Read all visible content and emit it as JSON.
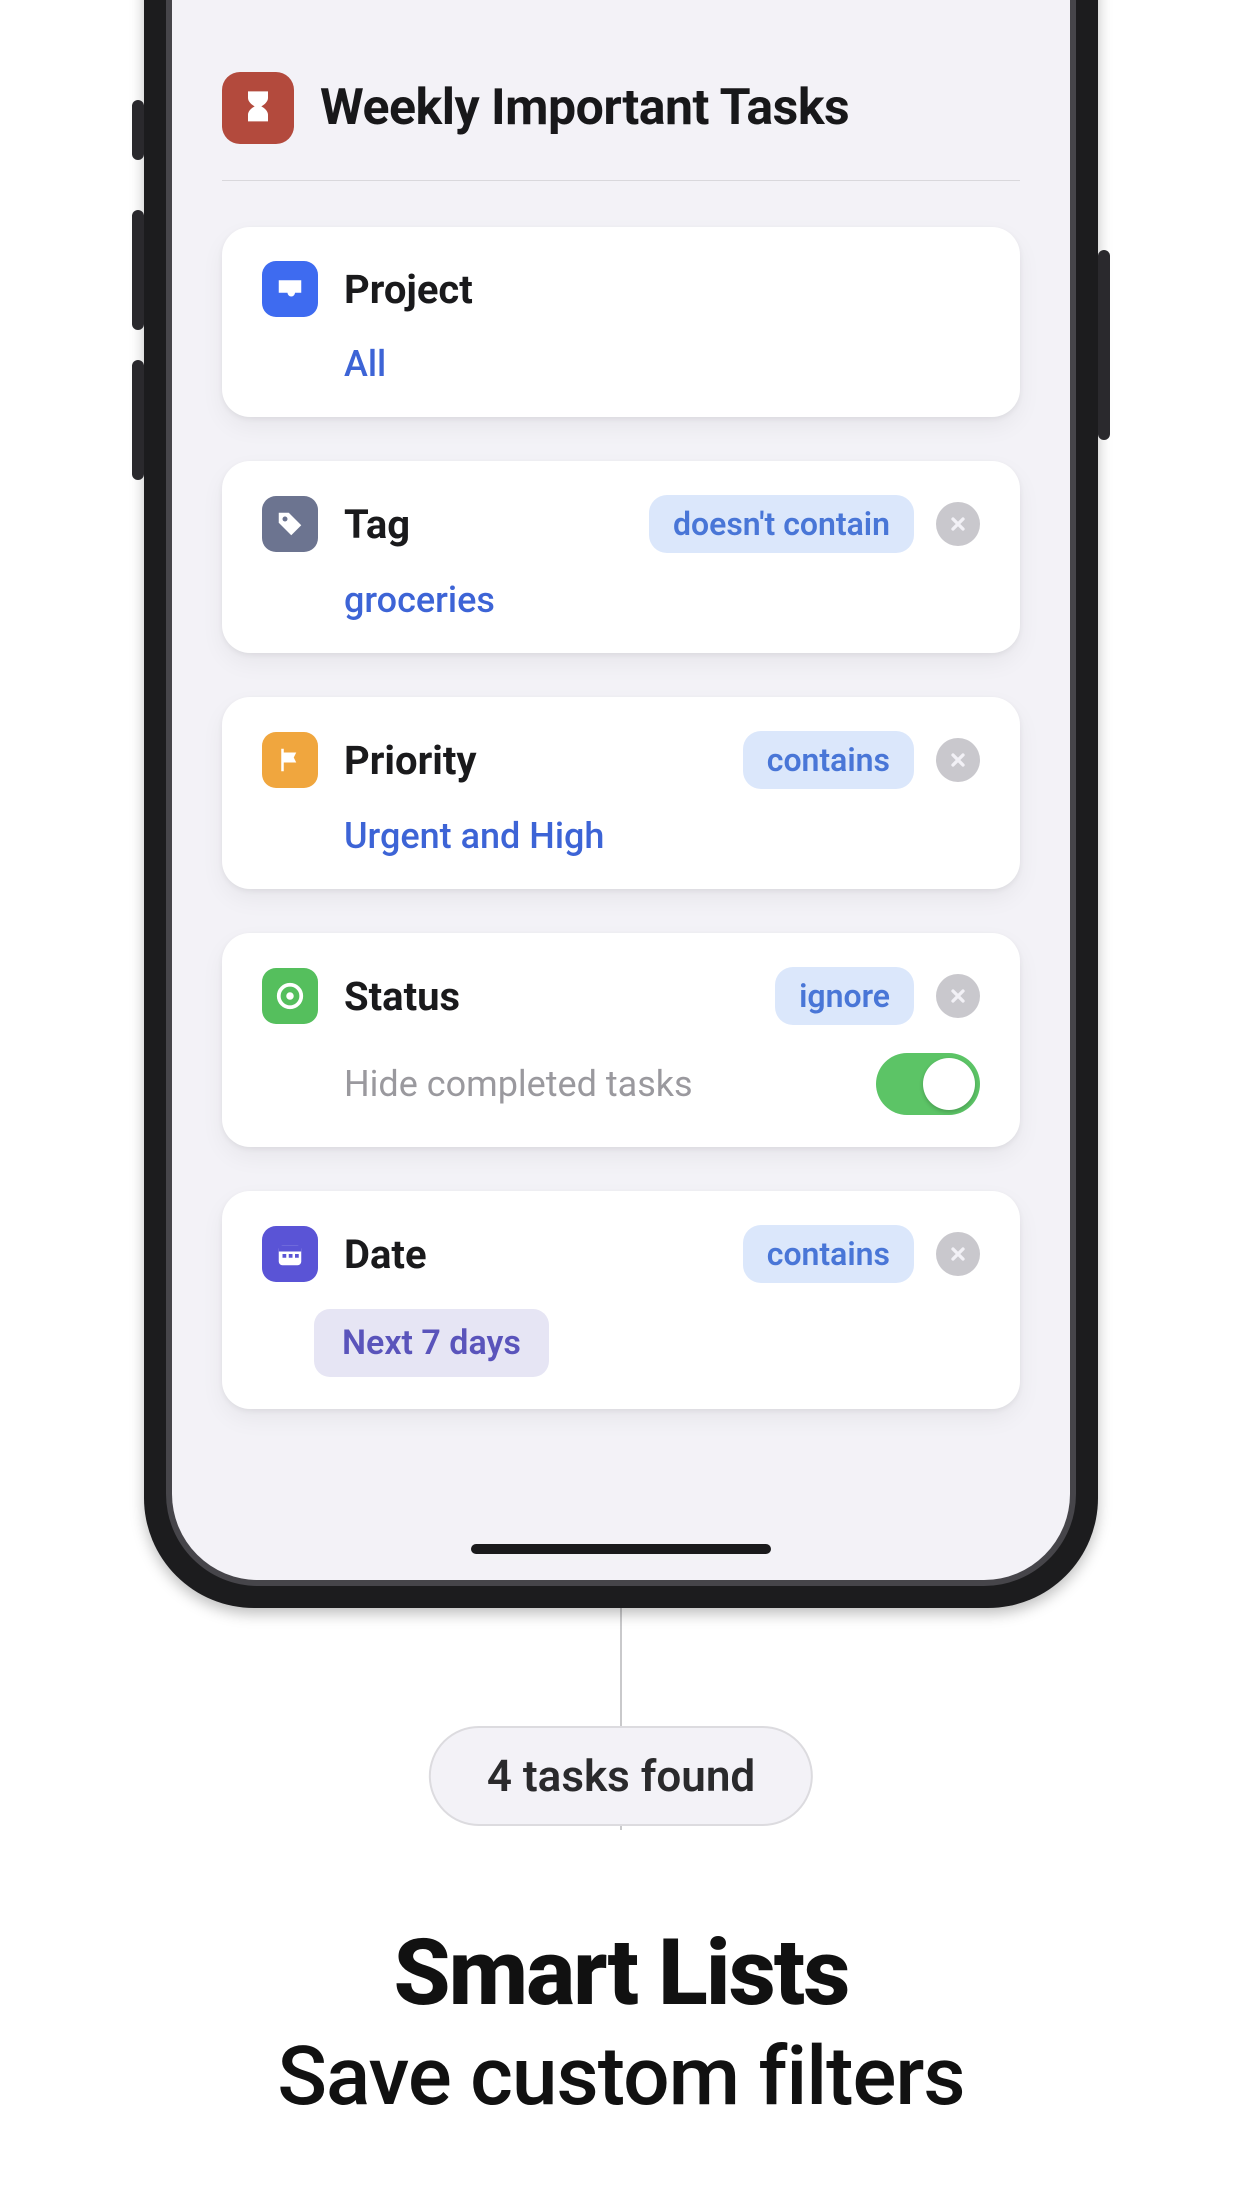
{
  "header": {
    "title": "Weekly Important Tasks"
  },
  "filters": {
    "project": {
      "title": "Project",
      "value": "All"
    },
    "tag": {
      "title": "Tag",
      "condition": "doesn't contain",
      "value": "groceries"
    },
    "priority": {
      "title": "Priority",
      "condition": "contains",
      "value": "Urgent and High"
    },
    "status": {
      "title": "Status",
      "condition": "ignore",
      "sub_label": "Hide completed tasks",
      "toggle_on": true
    },
    "date": {
      "title": "Date",
      "condition": "contains",
      "chip": "Next 7 days"
    }
  },
  "callout": "4 tasks found",
  "marketing": {
    "line1": "Smart Lists",
    "line2": "Save custom filters"
  }
}
